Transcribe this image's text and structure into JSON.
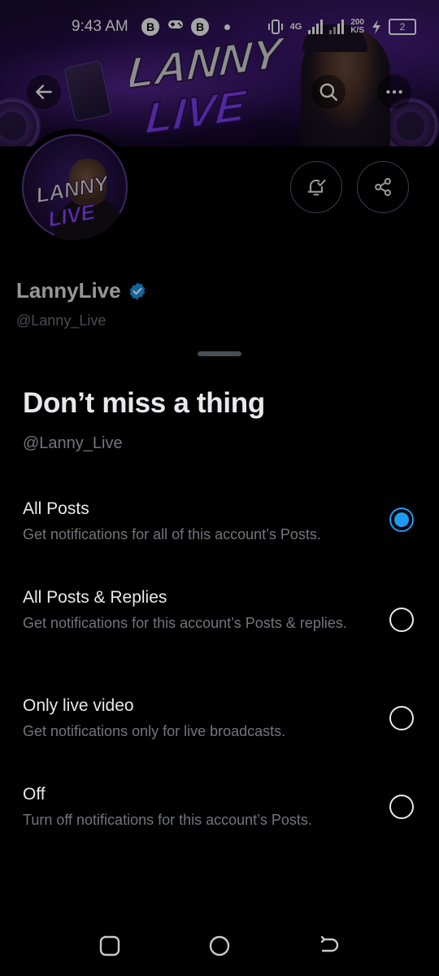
{
  "status_bar": {
    "time": "9:43 AM",
    "network": "4G",
    "speed_value": "200",
    "speed_unit": "K/S",
    "battery": "2"
  },
  "banner": {
    "wordmark_line1": "LANNY",
    "wordmark_line2": "LIVE",
    "icons": [
      "back-arrow-icon",
      "search-icon",
      "more-icon"
    ]
  },
  "profile": {
    "name": "LannyLive",
    "handle": "@Lanny_Live",
    "verified": true,
    "avatar_text_line1": "LANNY",
    "avatar_text_line2": "LIVE",
    "accent_color": "#1d9bf0"
  },
  "sheet": {
    "title": "Don’t miss a thing",
    "handle": "@Lanny_Live",
    "options": [
      {
        "label": "All Posts",
        "description": "Get notifications for all of this account’s Posts.",
        "selected": true
      },
      {
        "label": "All Posts & Replies",
        "description": "Get notifications for this account’s Posts & replies.",
        "selected": false
      },
      {
        "label": "Only live video",
        "description": "Get notifications only for live broadcasts.",
        "selected": false
      },
      {
        "label": "Off",
        "description": "Turn off notifications for this account’s Posts.",
        "selected": false
      }
    ]
  }
}
